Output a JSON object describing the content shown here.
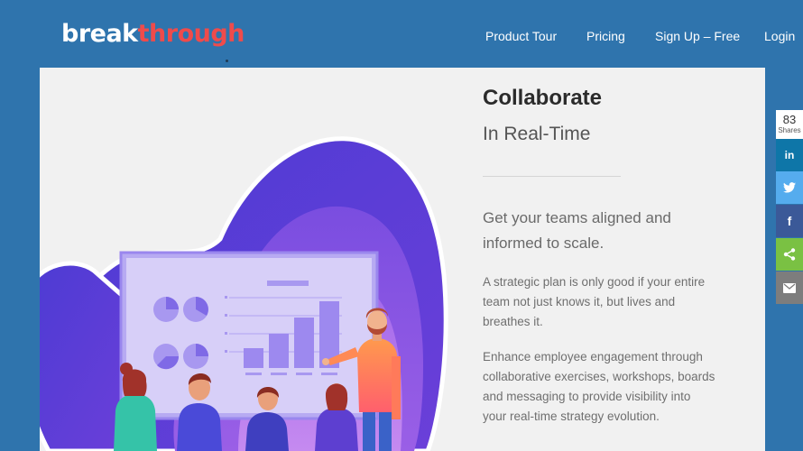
{
  "header": {
    "logo": {
      "part1": "break",
      "part2": "through"
    },
    "nav": [
      {
        "label": "Product Tour"
      },
      {
        "label": "Pricing"
      },
      {
        "label": "Sign Up – Free"
      },
      {
        "label": "Login"
      }
    ]
  },
  "hero": {
    "title": "Collaborate",
    "subtitle": "In Real-Time",
    "lead": "Get your teams aligned and informed to scale.",
    "paragraph1": "A strategic plan is only good if your entire team not just knows it, but lives and breathes it.",
    "paragraph2": "Enhance employee engagement through collaborative exercises, workshops, boards and messaging to provide visibility into your real-time strategy evolution."
  },
  "share_bar": {
    "count": "83",
    "count_label": "Shares",
    "buttons": [
      {
        "icon": "linkedin-icon",
        "glyph": "in",
        "color": "#0e76a8"
      },
      {
        "icon": "twitter-icon",
        "glyph": "🐦",
        "color": "#55acee"
      },
      {
        "icon": "facebook-icon",
        "glyph": "f",
        "color": "#3b5998"
      },
      {
        "icon": "share-icon",
        "glyph": "<",
        "color": "#7ac143"
      },
      {
        "icon": "email-icon",
        "glyph": "✉",
        "color": "#7d7d7d"
      }
    ]
  },
  "colors": {
    "header_bg": "#2f74ad",
    "logo_accent": "#ef4b4b",
    "illustration_purple": "#5b3fd6"
  }
}
